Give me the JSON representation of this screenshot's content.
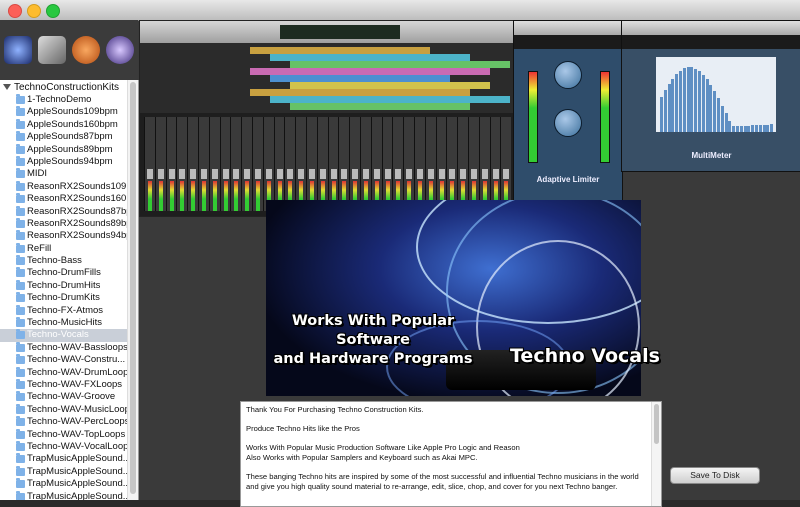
{
  "sidebar": {
    "root_label": "TechnoConstructionKits",
    "items": [
      {
        "label": "1-TechnoDemo"
      },
      {
        "label": "AppleSounds109bpm"
      },
      {
        "label": "AppleSounds160bpm"
      },
      {
        "label": "AppleSounds87bpm"
      },
      {
        "label": "AppleSounds89bpm"
      },
      {
        "label": "AppleSounds94bpm"
      },
      {
        "label": "MIDI"
      },
      {
        "label": "ReasonRX2Sounds109..."
      },
      {
        "label": "ReasonRX2Sounds160..."
      },
      {
        "label": "ReasonRX2Sounds87bpm"
      },
      {
        "label": "ReasonRX2Sounds89bpm"
      },
      {
        "label": "ReasonRX2Sounds94bpm"
      },
      {
        "label": "ReFill"
      },
      {
        "label": "Techno-Bass"
      },
      {
        "label": "Techno-DrumFills"
      },
      {
        "label": "Techno-DrumHits"
      },
      {
        "label": "Techno-DrumKits"
      },
      {
        "label": "Techno-FX-Atmos"
      },
      {
        "label": "Techno-MusicHits"
      },
      {
        "label": "Techno-Vocals"
      },
      {
        "label": "Techno-WAV-Bassloops"
      },
      {
        "label": "Techno-WAV-Constru..."
      },
      {
        "label": "Techno-WAV-DrumLoops"
      },
      {
        "label": "Techno-WAV-FXLoops"
      },
      {
        "label": "Techno-WAV-Groove"
      },
      {
        "label": "Techno-WAV-MusicLoops"
      },
      {
        "label": "Techno-WAV-PercLoops"
      },
      {
        "label": "Techno-WAV-TopLoops"
      },
      {
        "label": "Techno-WAV-VocalLoops"
      },
      {
        "label": "TrapMusicAppleSound..."
      },
      {
        "label": "TrapMusicAppleSound..."
      },
      {
        "label": "TrapMusicAppleSound..."
      },
      {
        "label": "TrapMusicAppleSound..."
      },
      {
        "label": "TrapMusicAppleSound..."
      }
    ],
    "selected_index": 19
  },
  "toolbar": {
    "icons": [
      "reason-icon",
      "samples-icon",
      "logic-icon",
      "instruments-icon"
    ]
  },
  "preview": {
    "caption_line1": "Works With Popular Software",
    "caption_line2": "and Hardware Programs",
    "caption_title": "Techno Vocals",
    "limiter_name": "Adaptive Limiter",
    "meter_name": "MultiMeter"
  },
  "description": {
    "paragraphs": [
      "Thank You For Purchasing Techno Construction Kits.",
      "Produce Techno Hits like the Pros",
      "Works With Popular Music Production Software Like Apple Pro Logic and Reason\nAlso Works with Popular Samplers and Keyboard such as Akai MPC.",
      "These banging Techno hits are inspired by some of the most successful and influential Techno musicians in the world and give you high quality sound material to re-arrange, edit, slice, chop, and cover for you next Techno banger."
    ]
  },
  "actions": {
    "save_label": "Save To Disk"
  },
  "colors": {
    "selection": "#c9cfd8",
    "folder": "#7fb2e8",
    "plugin_blue": "#2f4d6b"
  }
}
